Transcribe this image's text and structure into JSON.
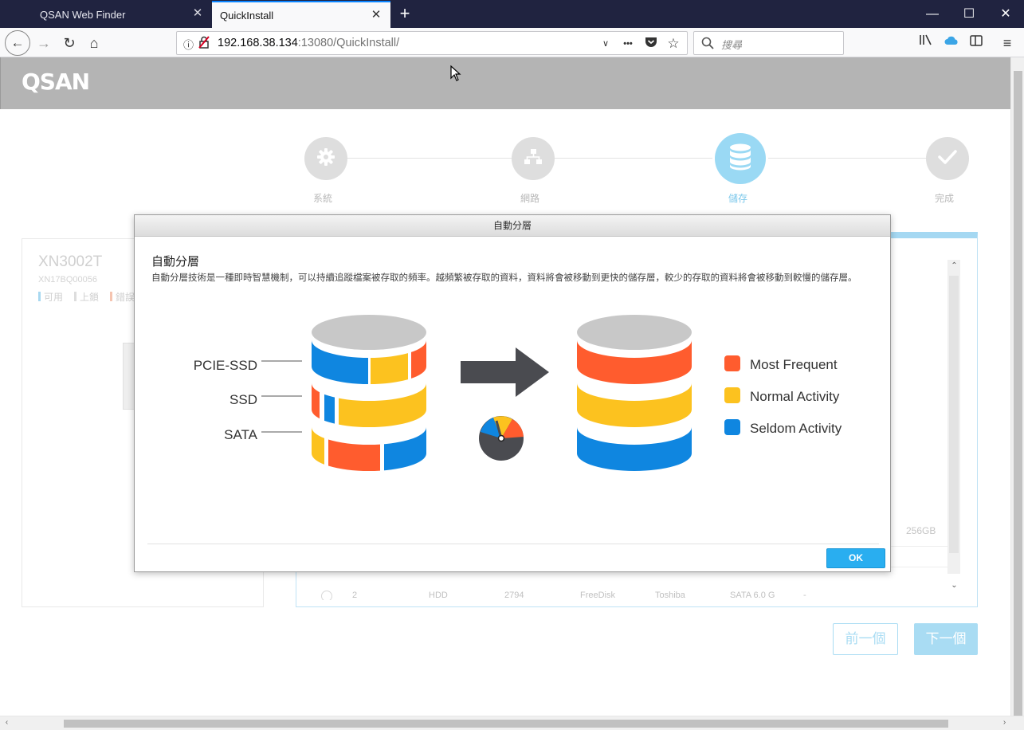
{
  "browser": {
    "tabs": [
      {
        "title": "QSAN Web Finder",
        "active": false
      },
      {
        "title": "QuickInstall",
        "active": true
      }
    ],
    "url_host": "192.168.38.134",
    "url_rest": ":13080/QuickInstall/",
    "search_placeholder": "搜尋",
    "menu_more": "•••"
  },
  "app": {
    "logo": "QSAN",
    "steps": [
      {
        "label": "系統",
        "icon": "gear-icon",
        "active": false
      },
      {
        "label": "網路",
        "icon": "network-icon",
        "active": false
      },
      {
        "label": "儲存",
        "icon": "database-icon",
        "active": true
      },
      {
        "label": "完成",
        "icon": "check-icon",
        "active": false
      }
    ],
    "device": {
      "model": "XN3002T",
      "serial": "XN17BQ00056",
      "legend": [
        {
          "label": "可用",
          "color": "#a8d8f0"
        },
        {
          "label": "上鎖",
          "color": "#dddddd"
        },
        {
          "label": "錯誤",
          "color": "#f5c4b0"
        }
      ]
    },
    "disk_table": {
      "size_text": "256GB",
      "row": {
        "index": "2",
        "type": "HDD",
        "capacity": "2794",
        "status": "FreeDisk",
        "vendor": "Toshiba",
        "interface": "SATA 6.0 G",
        "extra": "-"
      }
    },
    "buttons": {
      "prev": "前一個",
      "next": "下一個"
    }
  },
  "modal": {
    "title": "自動分層",
    "heading": "自動分層",
    "description": "自動分層技術是一種即時智慧機制，可以持續追蹤檔案被存取的頻率。越頻繁被存取的資料，資料將會被移動到更快的儲存層，較少的存取的資料將會被移動到較慢的儲存層。",
    "tiers": [
      "PCIE-SSD",
      "SSD",
      "SATA"
    ],
    "legend": [
      {
        "label": "Most Frequent",
        "color": "#ff5c2e"
      },
      {
        "label": "Normal Activity",
        "color": "#fcc21f"
      },
      {
        "label": "Seldom Activity",
        "color": "#0f86e0"
      }
    ],
    "ok_label": "OK"
  }
}
